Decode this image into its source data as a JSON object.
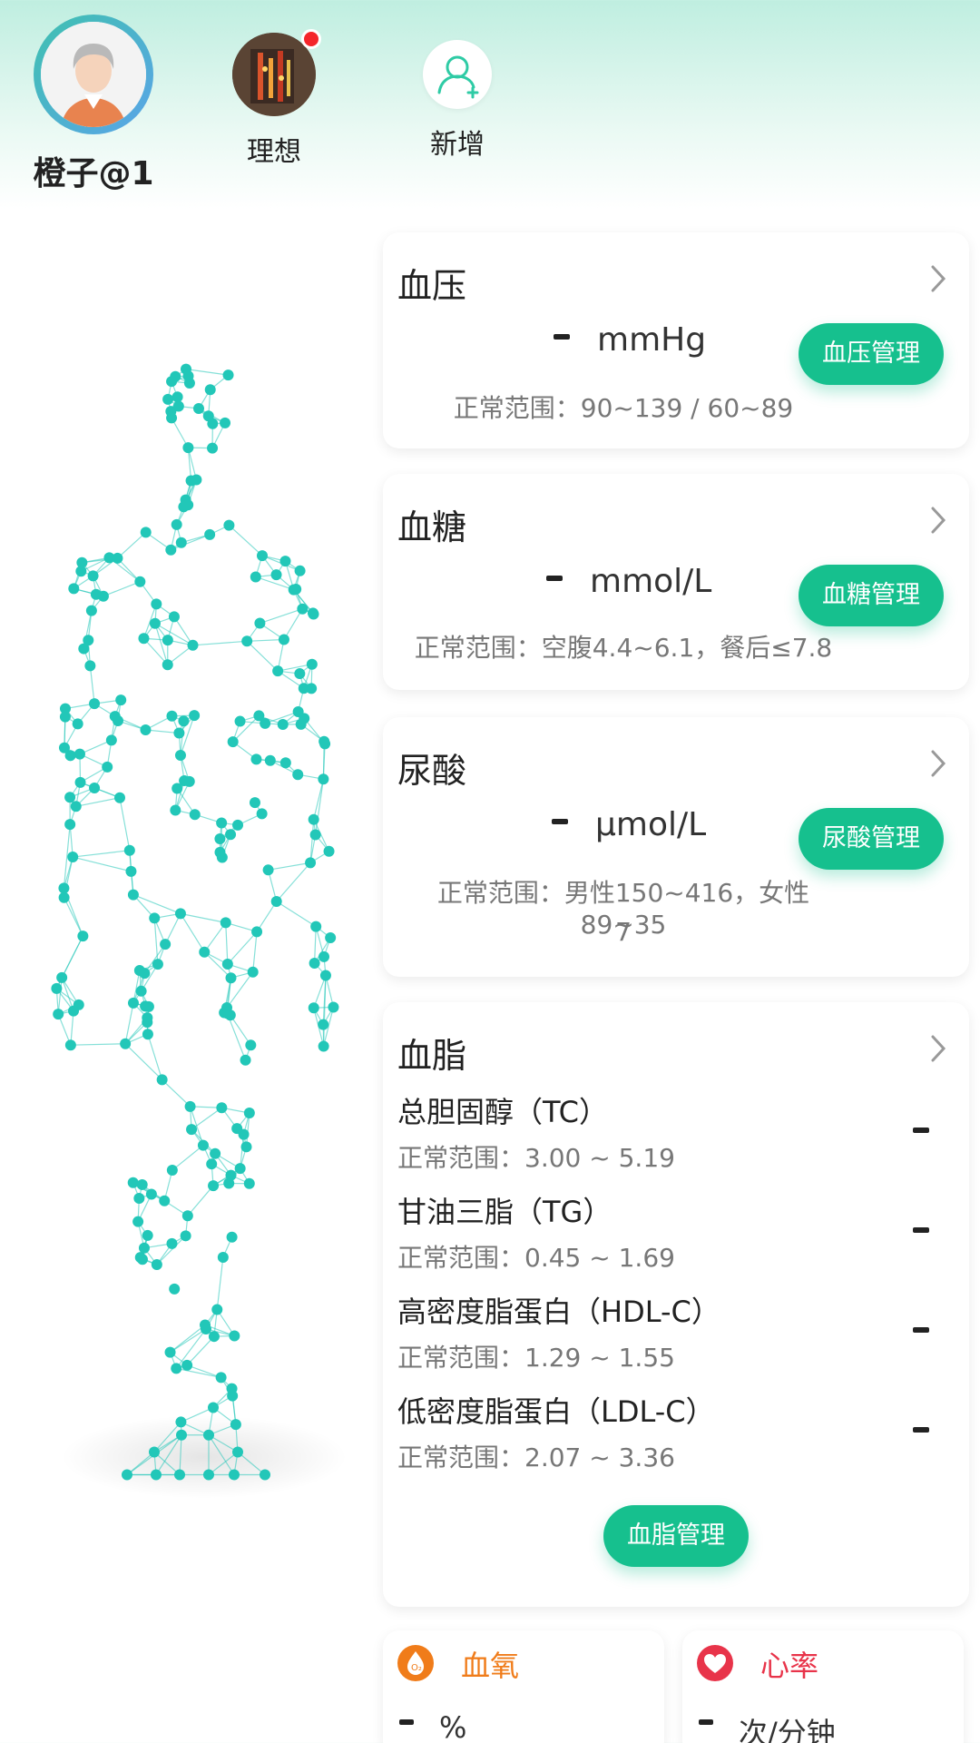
{
  "profiles": [
    {
      "name": "橙子@1",
      "active": true
    },
    {
      "name": "理想",
      "has_notification": true
    },
    {
      "name": "新增"
    }
  ],
  "cards": {
    "blood_pressure": {
      "title": "血压",
      "value": "-",
      "unit": "mmHg",
      "range": "正常范围：90~139 / 60~89",
      "button": "血压管理"
    },
    "blood_sugar": {
      "title": "血糖",
      "value": "-",
      "unit": "mmol/L",
      "range": "正常范围：空腹4.4~6.1，餐后≤7.8",
      "button": "血糖管理"
    },
    "uric_acid": {
      "title": "尿酸",
      "value": "-",
      "unit": "μmol/L",
      "range_line1": "正常范围：男性150~416，女性89~35",
      "range_line2": "7",
      "button": "尿酸管理"
    },
    "blood_lipids": {
      "title": "血脂",
      "items": [
        {
          "name": "总胆固醇（TC）",
          "range": "正常范围：3.00 ~ 5.19",
          "value": "-"
        },
        {
          "name": "甘油三脂（TG）",
          "range": "正常范围：0.45 ~ 1.69",
          "value": "-"
        },
        {
          "name": "高密度脂蛋白（HDL-C）",
          "range": "正常范围：1.29  ~ 1.55",
          "value": "-"
        },
        {
          "name": "低密度脂蛋白（LDL-C）",
          "range": "正常范围：2.07 ~ 3.36",
          "value": "-"
        }
      ],
      "button": "血脂管理"
    }
  },
  "mini_cards": {
    "blood_oxygen": {
      "label": "血氧",
      "value": "-",
      "unit": "%",
      "color": "#f07c1a",
      "icon": "oxygen-icon"
    },
    "heart_rate": {
      "label": "心率",
      "value": "-",
      "unit": "次/分钟",
      "color": "#e8344a",
      "icon": "heart-icon"
    }
  },
  "colors": {
    "accent": "#16c08e",
    "figure": "#22c7b8"
  }
}
